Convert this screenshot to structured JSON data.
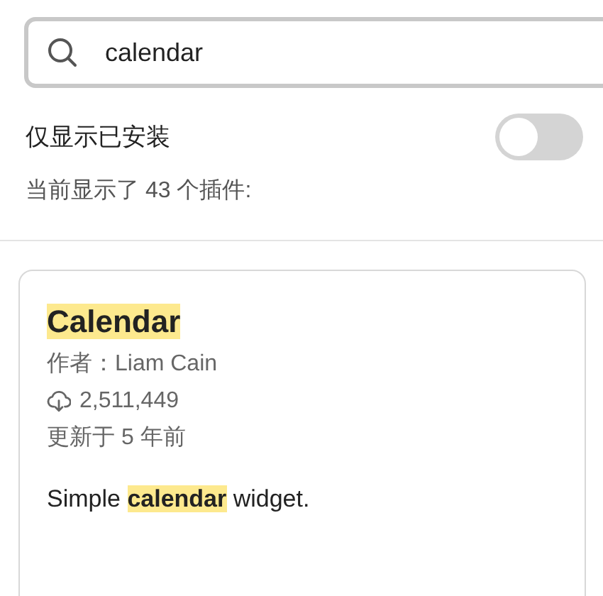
{
  "search": {
    "value": "calendar"
  },
  "filter": {
    "label": "仅显示已安装",
    "on": false
  },
  "count_text": "当前显示了 43 个插件:",
  "plugins": [
    {
      "title": "Calendar",
      "title_highlighted": true,
      "author": "作者：Liam Cain",
      "downloads": "2,511,449",
      "updated": "更新于 5 年前",
      "description": "Simple **calendar** widget."
    }
  ]
}
